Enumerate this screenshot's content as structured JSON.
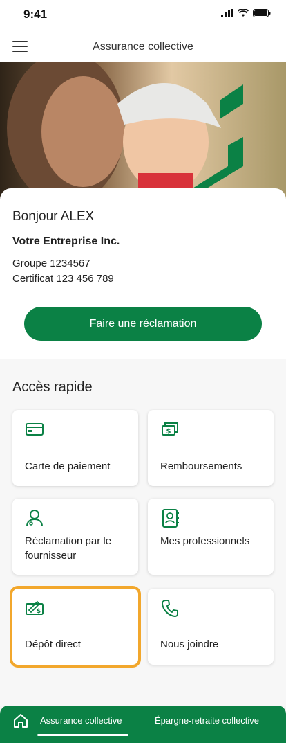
{
  "status_bar": {
    "time": "9:41"
  },
  "header": {
    "title": "Assurance collective",
    "menu_icon": "hamburger-menu-icon"
  },
  "welcome": {
    "greeting": "Bonjour ALEX",
    "company": "Votre Entreprise Inc.",
    "group": "Groupe 1234567",
    "certificate": "Certificat 123 456 789"
  },
  "claim_button_label": "Faire une réclamation",
  "quick_access": {
    "title": "Accès rapide",
    "tiles": [
      {
        "label": "Carte de paiement",
        "icon": "payment-card-icon"
      },
      {
        "label": "Remboursements",
        "icon": "reimbursements-icon"
      },
      {
        "label": "Réclamation par le fournisseur",
        "icon": "provider-claim-icon"
      },
      {
        "label": "Mes professionnels",
        "icon": "professionals-contacts-icon"
      },
      {
        "label": "Dépôt direct",
        "icon": "direct-deposit-icon"
      },
      {
        "label": "Nous joindre",
        "icon": "phone-icon"
      }
    ]
  },
  "bottom_nav": {
    "tabs": [
      {
        "label": "Assurance collective",
        "active": true
      },
      {
        "label": "Épargne-retraite collective",
        "active": false
      }
    ]
  },
  "colors": {
    "brand_green": "#0b8145",
    "highlight": "#f2a72c"
  }
}
